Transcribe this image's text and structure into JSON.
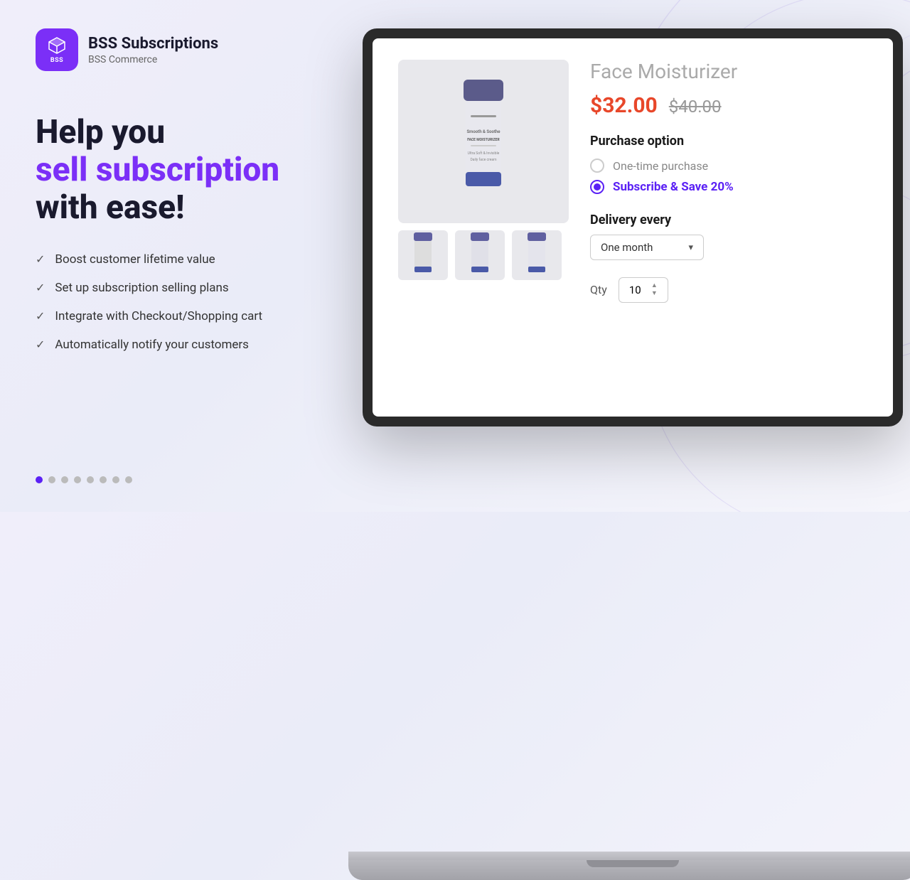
{
  "logo": {
    "title": "BSS Subscriptions",
    "subtitle": "BSS Commerce",
    "icon_text": "BSS",
    "icon_symbol": "⬡"
  },
  "hero": {
    "line1": "Help you",
    "line2": "sell subscription",
    "line3": "with ease!"
  },
  "features": [
    "Boost customer lifetime value",
    "Set up subscription selling plans",
    "Integrate with Checkout/Shopping cart",
    "Automatically notify your customers"
  ],
  "dots": {
    "total": 8,
    "active": 0
  },
  "product": {
    "name": "Face Moisturizer",
    "price_current": "$32.00",
    "price_original": "$40.00",
    "purchase_option_label": "Purchase option",
    "option_onetime": "One-time purchase",
    "option_subscribe": "Subscribe & Save 20%",
    "delivery_label": "Delivery every",
    "delivery_value": "One month",
    "qty_label": "Qty",
    "qty_value": "10"
  }
}
